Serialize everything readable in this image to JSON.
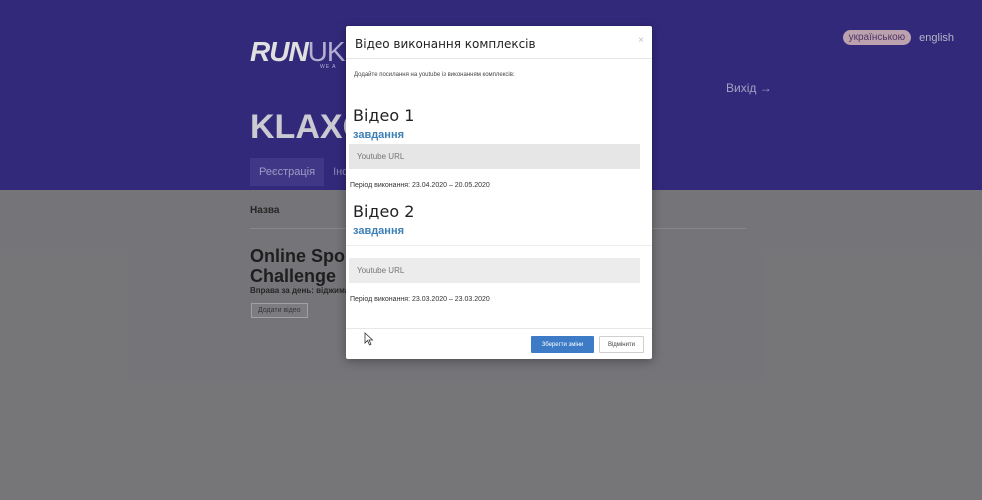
{
  "colors": {
    "header": "#3a2f8c",
    "accent": "#3d7bc6",
    "link": "#3c7fb6"
  },
  "lang": {
    "active": "українською",
    "inactive": "english"
  },
  "logo": {
    "bold": "RUN",
    "light": "UK",
    "tagline": "WE A"
  },
  "page": {
    "title": "KLAXO",
    "logout": "Вихід →"
  },
  "tabs": [
    "Реєстрація",
    "Інфо"
  ],
  "table": {
    "header": "Назва"
  },
  "card": {
    "title_line1": "Online Sport",
    "title_line2": "Challenge",
    "subtitle": "Вправа за день: віджиман",
    "add_button": "Додати відео"
  },
  "modal": {
    "title": "Відео виконання комплексів",
    "close": "×",
    "description": "Додайте посилання на youtube із виконанням комплексів:",
    "videos": [
      {
        "heading": "Відео 1",
        "task_link": "завдання",
        "url_placeholder": "Youtube URL",
        "period": "Період виконання: 23.04.2020 – 20.05.2020"
      },
      {
        "heading": "Відео 2",
        "task_link": "завдання",
        "url_placeholder": "Youtube URL",
        "period": "Період виконання: 23.03.2020 – 23.03.2020"
      }
    ],
    "save_button": "Зберегти зміни",
    "cancel_button": "Відмінити"
  }
}
